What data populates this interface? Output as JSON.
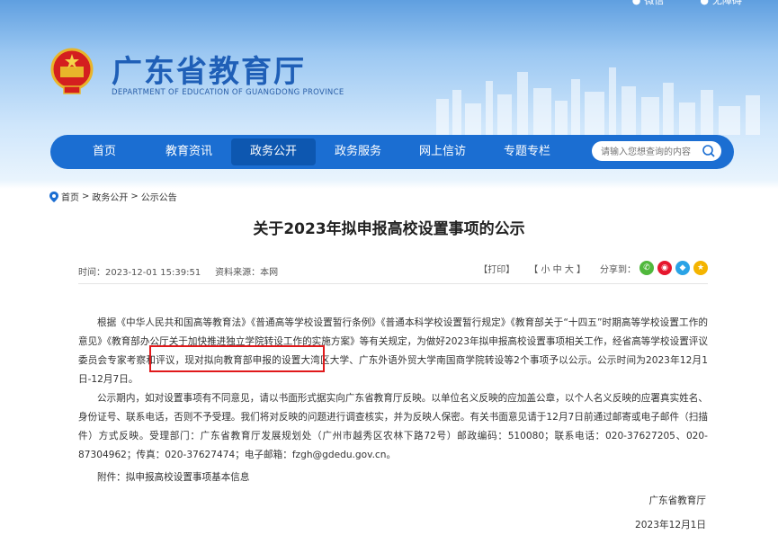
{
  "topbar": {
    "weibo": "微信",
    "accessibility": "无障碍"
  },
  "site": {
    "title": "广东省教育厅",
    "subtitle": "DEPARTMENT OF EDUCATION OF GUANGDONG PROVINCE"
  },
  "nav": {
    "items": [
      "首页",
      "教育资讯",
      "政务公开",
      "政务服务",
      "网上信访",
      "专题专栏"
    ],
    "active": "政务公开"
  },
  "search": {
    "placeholder": "请输入您想查询的内容"
  },
  "breadcrumb": {
    "home": "首页",
    "sep": ">",
    "level1": "政务公开",
    "level2": "公示公告"
  },
  "article": {
    "title": "关于2023年拟申报高校设置事项的公示",
    "time": "时间：2023-12-01 15:39:51",
    "source": "资料来源：本网",
    "print": "【打印】",
    "font_size": "【 小  中  大 】",
    "share_label": "分享到：",
    "paragraphs": [
      "根据《中华人民共和国高等教育法》《普通高等学校设置暂行条例》《普通本科学校设置暂行规定》《教育部关于“十四五”时期高等学校设置工作的意见》《教育部办公厅关于加快推进独立学院转设工作的实施方案》等有关规定，为做好2023年拟申报高校设置事项相关工作，经省高等学校设置评议委员会专家考察和评议，现对拟向教育部申报的设置大湾区大学、广东外语外贸大学南国商学院转设等2个事项予以公示。公示时间为2023年12月1日-12月7日。",
      "公示期内，如对设置事项有不同意见，请以书面形式据实向广东省教育厅反映。以单位名义反映的应加盖公章，以个人名义反映的应署真实姓名、身份证号、联系电话，否则不予受理。我们将对反映的问题进行调查核实，并为反映人保密。有关书面意见请于12月7日前通过邮寄或电子邮件（扫描件）方式反映。受理部门：广东省教育厅发展规划处（广州市越秀区农林下路72号）邮政编码：510080；联系电话：020-37627205、020-87304962；传真：020-37627474；电子邮箱：fzgh@gdedu.gov.cn。"
    ],
    "attachment": "附件：拟申报高校设置事项基本信息",
    "signature": "广东省教育厅",
    "date": "2023年12月1日"
  },
  "colors": {
    "nav": "#1b6ed2",
    "title_blue": "#1f5fb7",
    "highlight": "#e0191b"
  }
}
